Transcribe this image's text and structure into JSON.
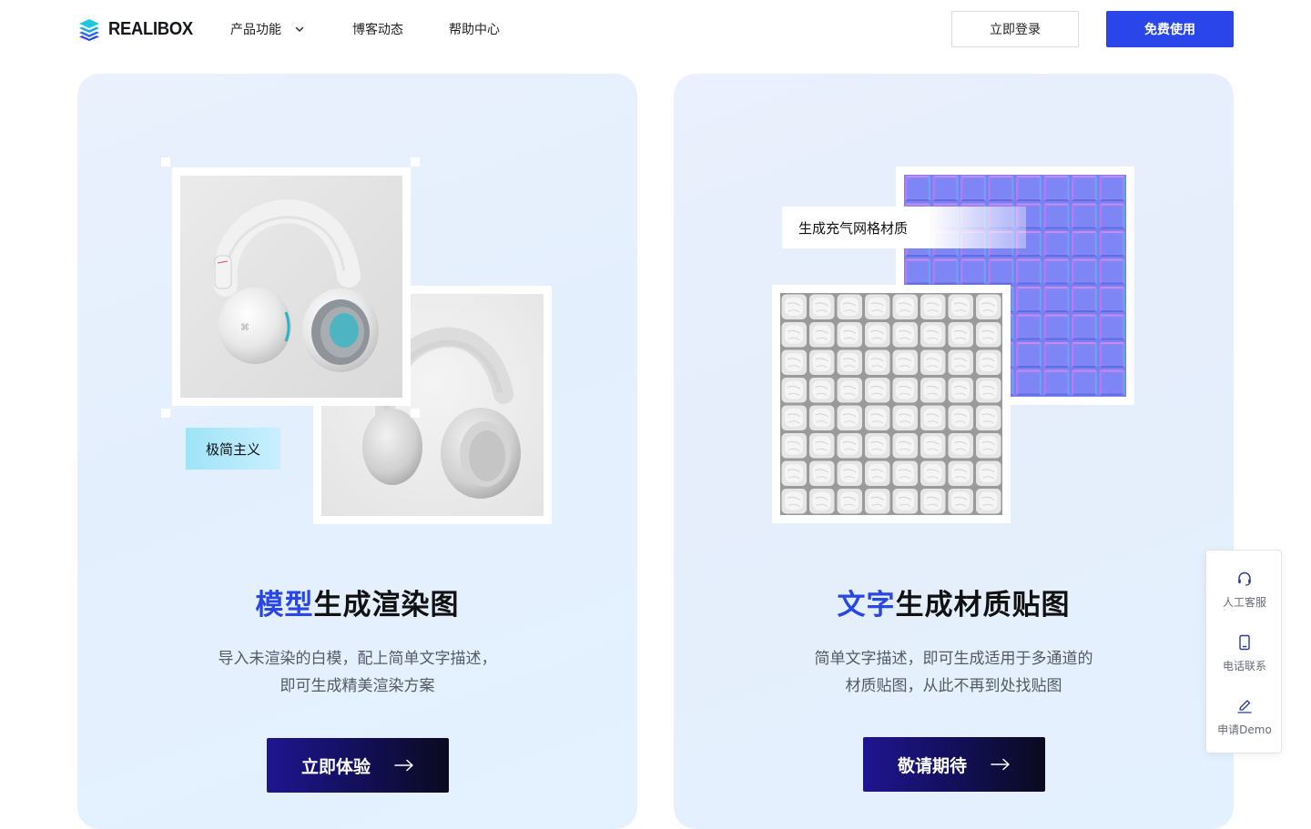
{
  "brand": {
    "name": "REALIBOX",
    "accent": "#2a46ea"
  },
  "nav": {
    "items": [
      {
        "label": "产品功能",
        "has_dropdown": true
      },
      {
        "label": "博客动态"
      },
      {
        "label": "帮助中心"
      }
    ],
    "login_label": "立即登录",
    "free_label": "免费使用"
  },
  "cards": [
    {
      "tag": "极简主义",
      "title_highlight": "模型",
      "title_rest": "生成渲染图",
      "desc_line1": "导入未渲染的白模，配上简单文字描述，",
      "desc_line2": "即可生成精美渲染方案",
      "cta": "立即体验"
    },
    {
      "tag": "生成充气网格材质",
      "title_highlight": "文字",
      "title_rest": "生成材质贴图",
      "desc_line1": "简单文字描述，即可生成适用于多通道的",
      "desc_line2": "材质贴图，从此不再到处找贴图",
      "cta": "敬请期待"
    }
  ],
  "side_panel": {
    "items": [
      {
        "label": "人工客服",
        "icon": "headset-icon"
      },
      {
        "label": "电话联系",
        "icon": "phone-icon"
      },
      {
        "label": "申请Demo",
        "icon": "pen-icon"
      }
    ]
  }
}
